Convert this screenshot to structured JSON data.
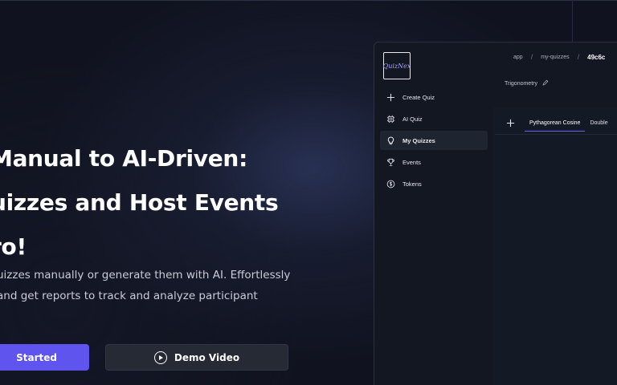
{
  "hero": {
    "title_lines": [
      "Manual to AI-Driven:",
      "uizzes and Host Events",
      "ro!"
    ],
    "description_lines": [
      "uizzes manually or generate them with AI. Effortlessly",
      "and get reports to track and analyze participant"
    ],
    "start_button": "Started",
    "demo_button": "Demo Video"
  },
  "app": {
    "logo_text": "QuizNex",
    "sidebar": {
      "items": [
        {
          "label": "Create Quiz",
          "icon": "plus-icon"
        },
        {
          "label": "AI Quiz",
          "icon": "chip-icon"
        },
        {
          "label": "My Quizzes",
          "icon": "lightbulb-icon",
          "active": true
        },
        {
          "label": "Events",
          "icon": "trophy-icon"
        },
        {
          "label": "Tokens",
          "icon": "dollar-coin-icon"
        }
      ]
    },
    "breadcrumb": [
      "app",
      "my-quizzes",
      "49c6c"
    ],
    "quiz_name": "Trigonometry",
    "tabs": [
      {
        "label": "Pythagorean Cosine",
        "active": true
      },
      {
        "label": "Double"
      }
    ]
  },
  "colors": {
    "background": "#10131f",
    "accent": "#5f55ee",
    "tab_underline": "#6a60f2",
    "panel": "#131722"
  }
}
